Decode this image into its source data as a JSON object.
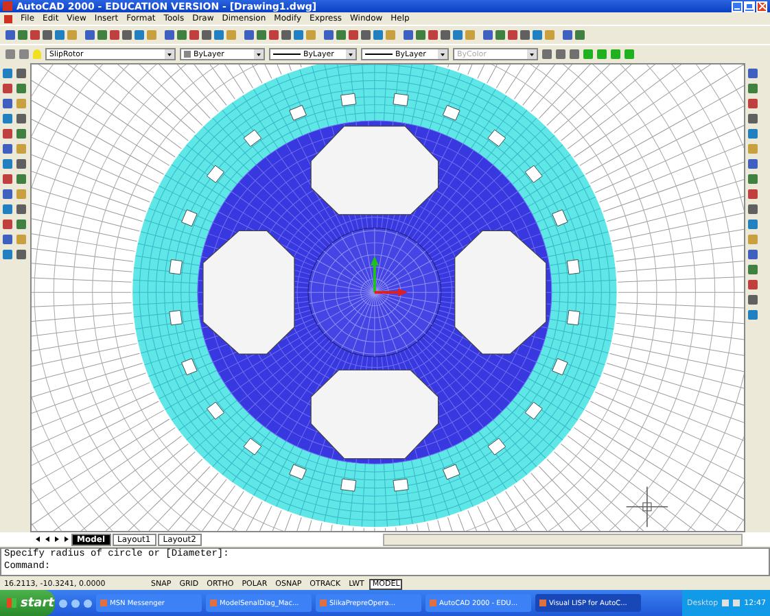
{
  "window": {
    "title": "AutoCAD 2000 - EDUCATION VERSION - [Drawing1.dwg]"
  },
  "menu": [
    "File",
    "Edit",
    "View",
    "Insert",
    "Format",
    "Tools",
    "Draw",
    "Dimension",
    "Modify",
    "Express",
    "Window",
    "Help"
  ],
  "properties_bar": {
    "layer": "SlipRotor",
    "color_setting": "ByLayer",
    "linetype": "ByLayer",
    "lineweight": "ByLayer",
    "plot_style": "ByColor"
  },
  "layout_tabs": [
    {
      "label": "Model",
      "selected": true
    },
    {
      "label": "Layout1",
      "selected": false
    },
    {
      "label": "Layout2",
      "selected": false
    }
  ],
  "command_lines": [
    "Specify radius of circle or [Diameter]:",
    "Command:"
  ],
  "status_bar": {
    "coordinates": "16.2113, -10.3241, 0.0000",
    "toggles": [
      {
        "label": "SNAP",
        "on": false
      },
      {
        "label": "GRID",
        "on": false
      },
      {
        "label": "ORTHO",
        "on": false
      },
      {
        "label": "POLAR",
        "on": false
      },
      {
        "label": "OSNAP",
        "on": false
      },
      {
        "label": "OTRACK",
        "on": false
      },
      {
        "label": "LWT",
        "on": false
      },
      {
        "label": "MODEL",
        "on": true
      }
    ]
  },
  "taskbar": {
    "start": "start",
    "items": [
      {
        "label": "MSN Messenger",
        "selected": false
      },
      {
        "label": "ModelSenalDiag_Mac...",
        "selected": false
      },
      {
        "label": "SlikaPrepreOpera...",
        "selected": false
      },
      {
        "label": "AutoCAD 2000 - EDU...",
        "selected": false
      },
      {
        "label": "Visual LISP for AutoC...",
        "selected": true
      }
    ],
    "desktop": "Desktop",
    "clock": "12:47"
  }
}
